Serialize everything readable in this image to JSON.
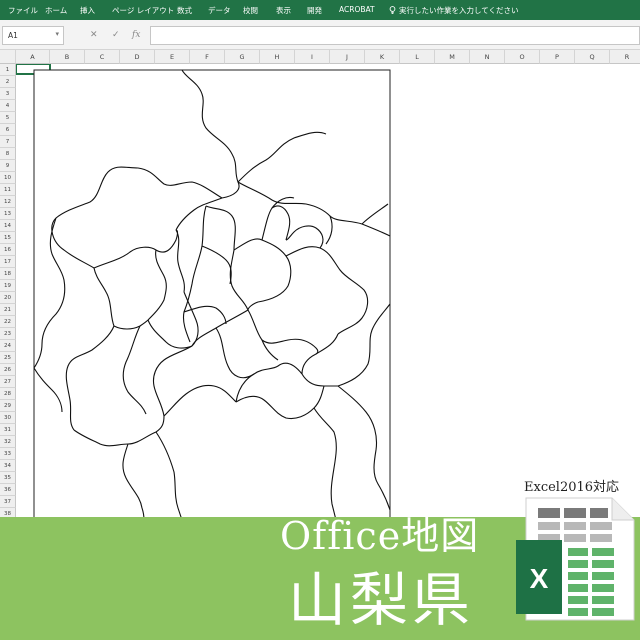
{
  "ribbon": {
    "tabs": [
      "ファイル",
      "ホーム",
      "挿入",
      "ページ レイアウト",
      "数式",
      "データ",
      "校閲",
      "表示",
      "開発",
      "ACROBAT"
    ],
    "tell_me": "実行したい作業を入力してください"
  },
  "formula_bar": {
    "name_box": "A1",
    "cancel_glyph": "✕",
    "enter_glyph": "✓",
    "fx_glyph": "fx",
    "formula": ""
  },
  "columns": [
    "A",
    "B",
    "C",
    "D",
    "E",
    "F",
    "G",
    "H",
    "I",
    "J",
    "K",
    "L",
    "M",
    "N",
    "O",
    "P",
    "Q",
    "R"
  ],
  "rows": [
    "1",
    "2",
    "3",
    "4",
    "5",
    "6",
    "7",
    "8",
    "9",
    "10",
    "11",
    "12",
    "13",
    "14",
    "15",
    "16",
    "17",
    "18",
    "19",
    "20",
    "21",
    "22",
    "23",
    "24",
    "25",
    "26",
    "27",
    "28",
    "29",
    "30",
    "31",
    "32",
    "33",
    "34",
    "35",
    "36",
    "37",
    "38"
  ],
  "banner": {
    "title": "Office地図",
    "prefecture": "山梨県",
    "version": "Excel2016対応",
    "icon_letter": "X"
  },
  "colors": {
    "ribbon": "#217346",
    "banner": "#8dc360",
    "excel_green": "#1e7145"
  }
}
